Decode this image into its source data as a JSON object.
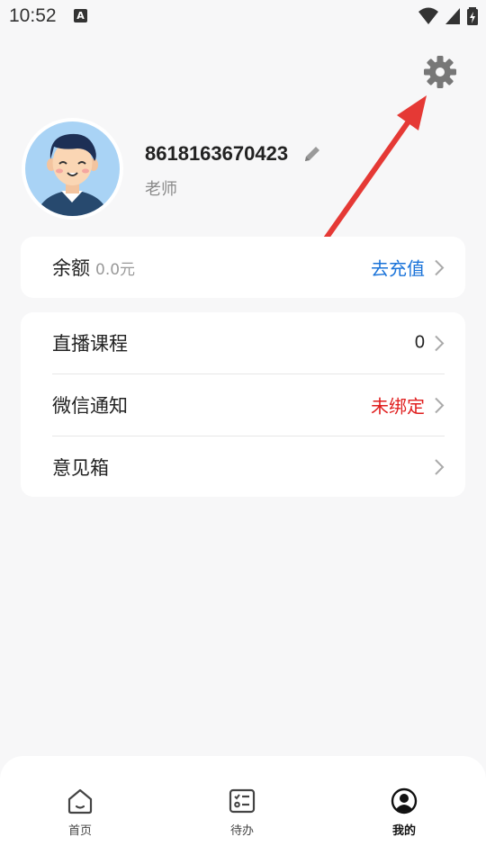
{
  "status_bar": {
    "time": "10:52",
    "notification_icon": "a-icon",
    "icons": [
      "wifi-icon",
      "signal-icon",
      "battery-charging-icon"
    ]
  },
  "header": {
    "settings_icon": "gear-icon"
  },
  "profile": {
    "phone": "8618163670423",
    "role": "老师",
    "avatar": "avatar-boy"
  },
  "balance": {
    "label": "余额",
    "value": "0.0元",
    "action": "去充值"
  },
  "menu": {
    "items": [
      {
        "label": "直播课程",
        "value": "0"
      },
      {
        "label": "微信通知",
        "value": "未绑定"
      },
      {
        "label": "意见箱",
        "value": ""
      }
    ]
  },
  "bottom_nav": {
    "items": [
      {
        "label": "首页",
        "icon": "home-icon"
      },
      {
        "label": "待办",
        "icon": "todo-icon"
      },
      {
        "label": "我的",
        "icon": "profile-icon"
      }
    ],
    "active": "我的"
  },
  "colors": {
    "accent_blue": "#1a73d9",
    "alert_red": "#e01e1e",
    "annotation_arrow": "#e53935"
  }
}
